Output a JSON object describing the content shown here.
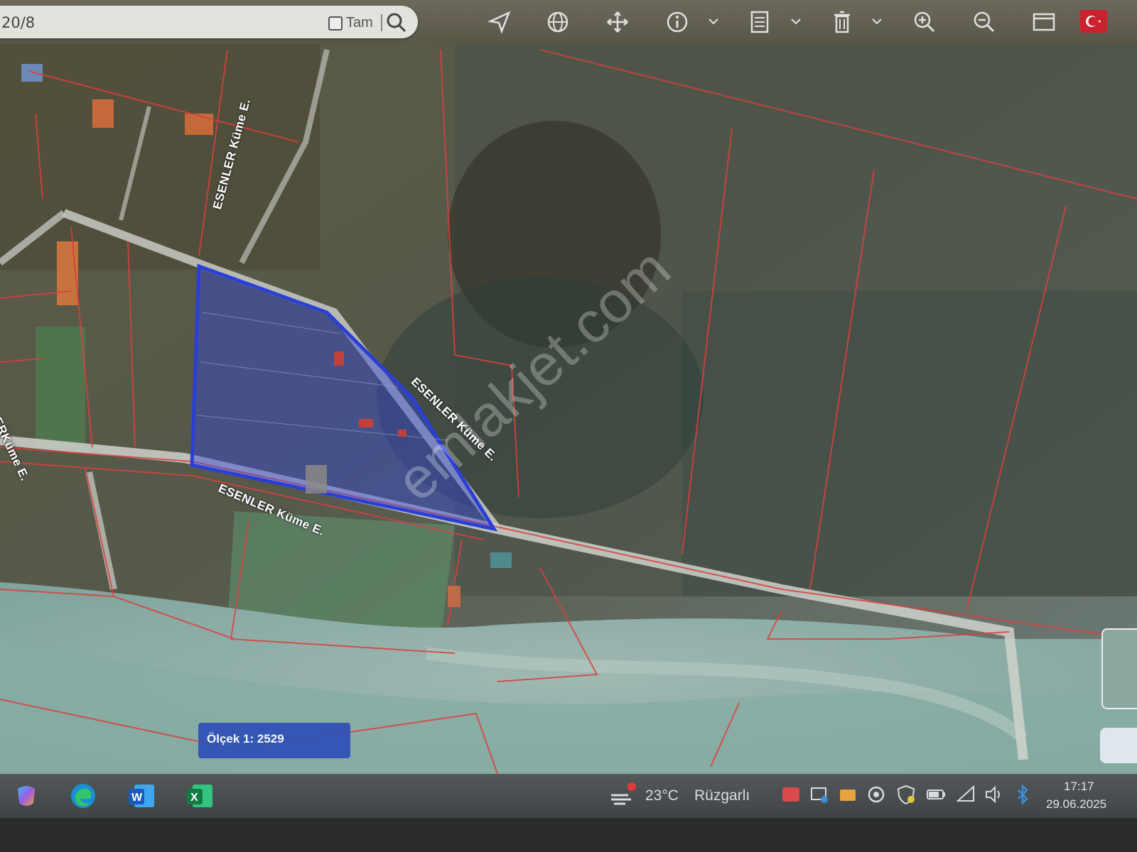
{
  "search": {
    "value": "20/8",
    "tam_label": "Tam"
  },
  "toolbar": {
    "buttons": [
      "navigate-icon",
      "globe-icon",
      "pan-icon",
      "info-icon",
      "layers-list-icon",
      "trash-icon",
      "zoom-in-icon",
      "zoom-out-icon",
      "window-icon",
      "flag-icon"
    ]
  },
  "map": {
    "road_labels": [
      "ESENLER Küme E.",
      "ESENLER Küme E.",
      "ESENLER Küme E.",
      "ERKüme E."
    ],
    "watermark": "emlakjet.com",
    "scale_label": "Ölçek 1:  2529",
    "colors": {
      "parcel_line": "#d9403f",
      "selected_parcel": "#2b3fd6"
    }
  },
  "taskbar": {
    "apps": [
      "copilot-icon",
      "edge-icon",
      "word-icon",
      "excel-icon"
    ],
    "weather": {
      "temp": "23°C",
      "desc": "Rüzgarlı"
    },
    "clock": {
      "time": "17:17",
      "date": "29.06.2025"
    }
  }
}
